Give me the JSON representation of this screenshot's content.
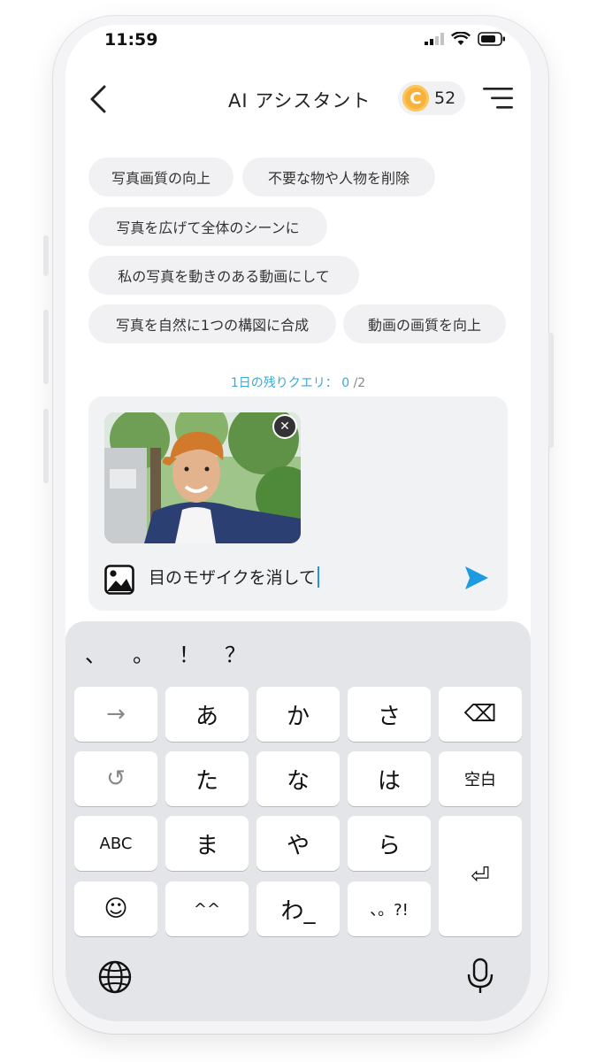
{
  "status": {
    "time": "11:59"
  },
  "header": {
    "title": "AI アシスタント",
    "coin_symbol": "C",
    "coins": "52"
  },
  "chips": [
    "写真画質の向上",
    "不要な物や人物を削除",
    "写真を広げて全体のシーンに",
    "私の写真を動きのある動画にして",
    "写真を自然に1つの構図に合成",
    "動画の画質を向上"
  ],
  "queries": {
    "label": "1日の残りクエリ：",
    "used": "0",
    "total": "/2"
  },
  "input": {
    "text": "目のモザイクを消して",
    "remove_symbol": "✕"
  },
  "keyboard": {
    "punctuation": [
      "、",
      "。",
      "！",
      "？"
    ],
    "rows": [
      [
        "→",
        "あ",
        "か",
        "さ",
        "⌫"
      ],
      [
        "↺",
        "た",
        "な",
        "は",
        "空白"
      ],
      [
        "ABC",
        "ま",
        "や",
        "ら",
        "⏎"
      ],
      [
        "☺",
        "^^",
        "わ_",
        "、。?!"
      ]
    ]
  },
  "colors": {
    "accent": "#3aa8d8",
    "coin": "#f7b23b",
    "chip_bg": "#f1f1f3",
    "keyboard_bg": "#e4e5e8"
  }
}
